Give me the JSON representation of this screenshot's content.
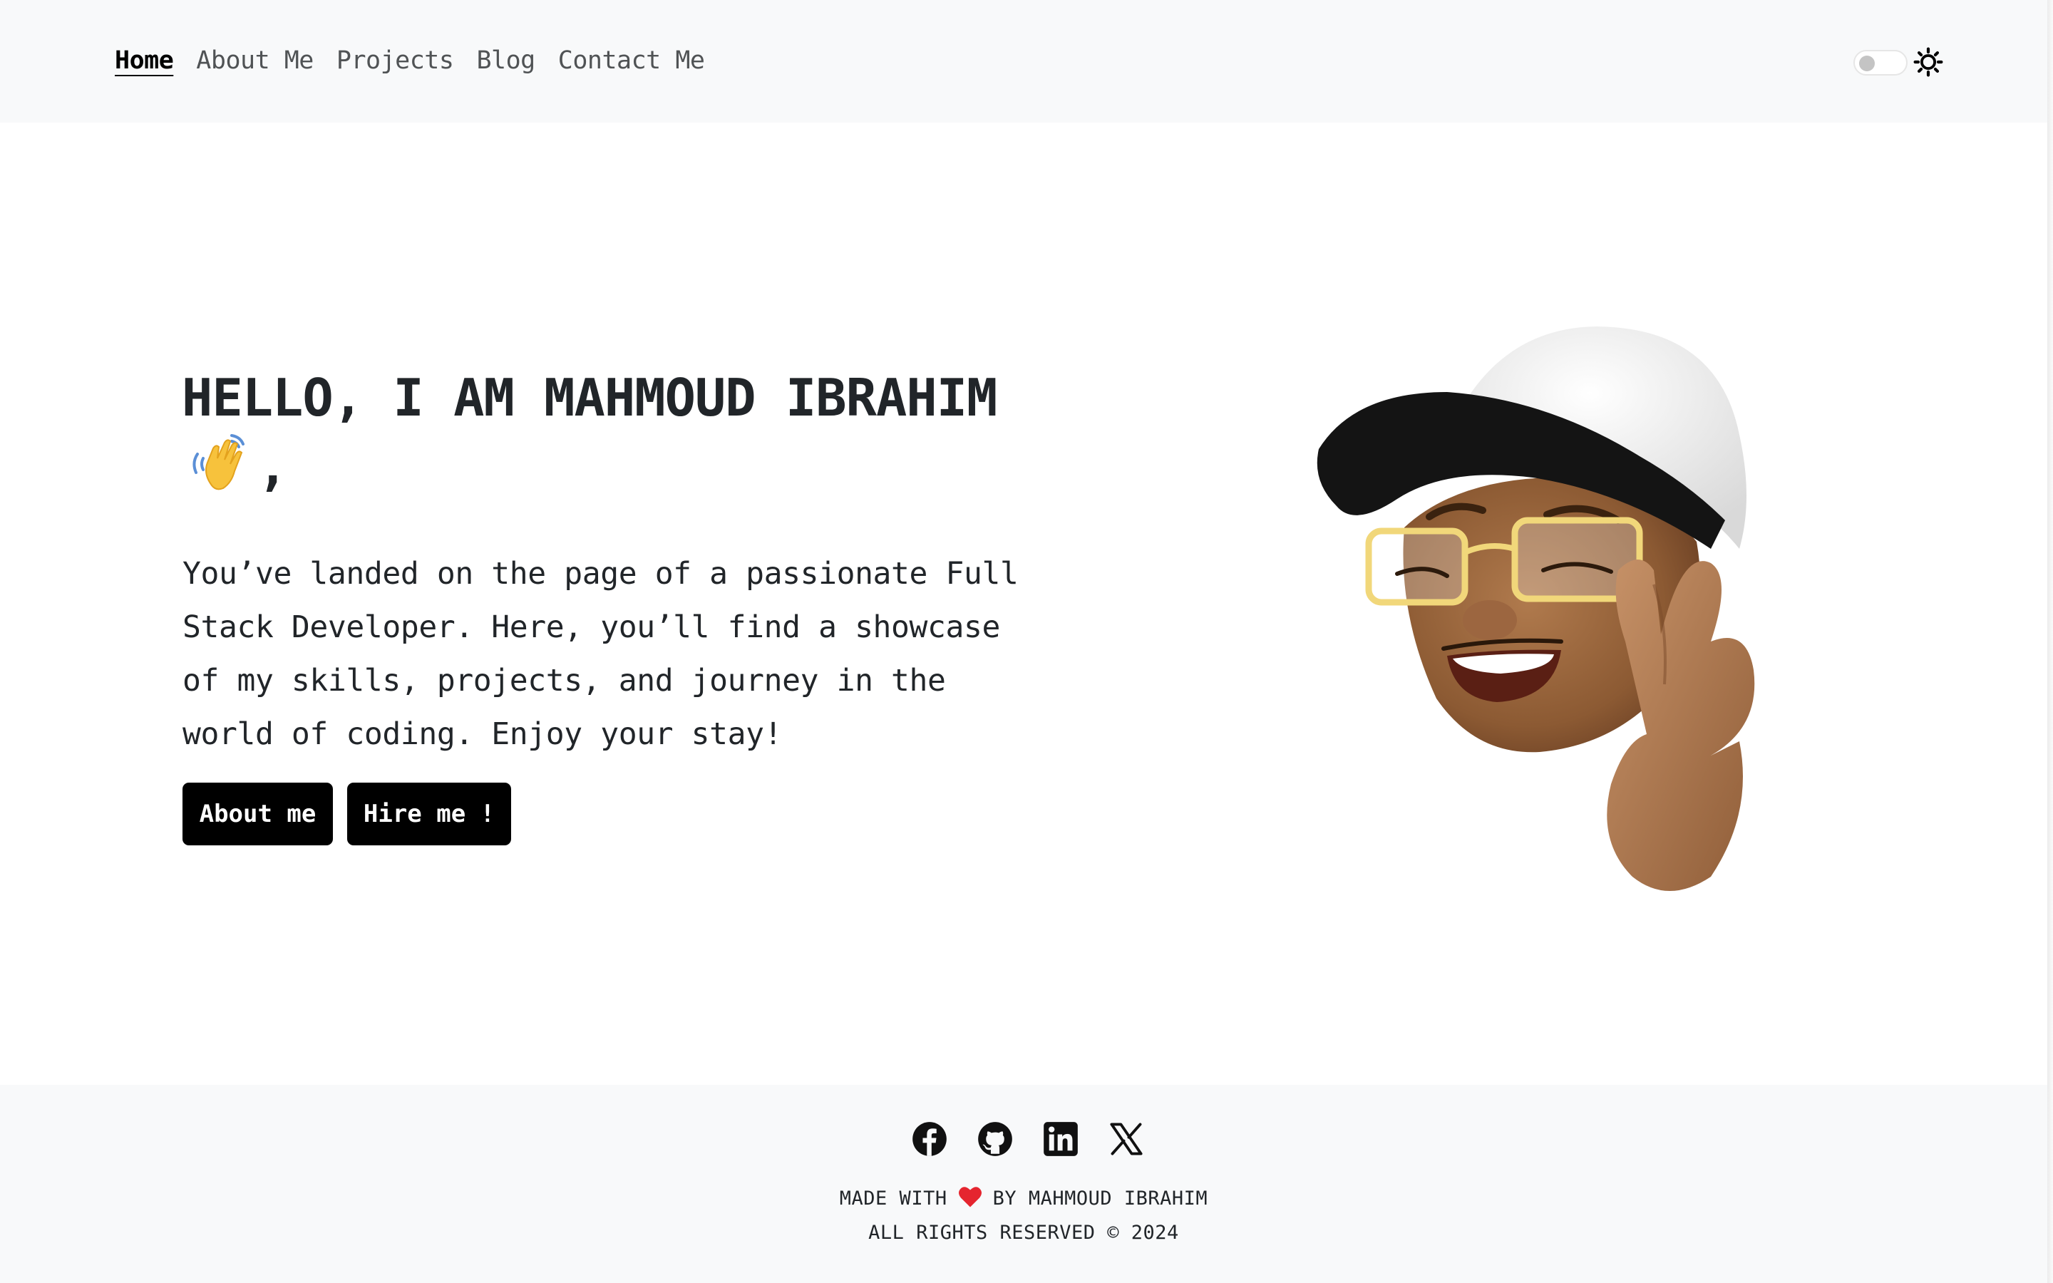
{
  "nav": {
    "items": [
      {
        "label": "Home",
        "active": true
      },
      {
        "label": "About Me"
      },
      {
        "label": "Projects"
      },
      {
        "label": "Blog"
      },
      {
        "label": "Contact Me"
      }
    ]
  },
  "theme": {
    "toggle_state": "off",
    "icon": "sun-icon"
  },
  "hero": {
    "title": "HELLO, I AM MAHMOUD IBRAHIM",
    "title_suffix": ",",
    "wave_icon": "waving-hand-icon",
    "intro": "You’ve landed on the page of a passionate Full Stack Developer. Here, you’ll find a showcase of my skills, projects, and journey in the world of coding. Enjoy your stay!",
    "about_button": "About me",
    "hire_button": "Hire me !",
    "avatar_icon": "memoji-avatar"
  },
  "footer": {
    "socials": [
      "facebook-icon",
      "github-icon",
      "linkedin-icon",
      "x-icon"
    ],
    "made_with_prefix": "MADE WITH",
    "made_with_suffix": "BY MAHMOUD IBRAHIM",
    "copyright": "ALL RIGHTS RESERVED © 2024"
  },
  "colors": {
    "button_bg": "#000000",
    "band_bg": "#f8f9fa",
    "text": "#212529"
  }
}
